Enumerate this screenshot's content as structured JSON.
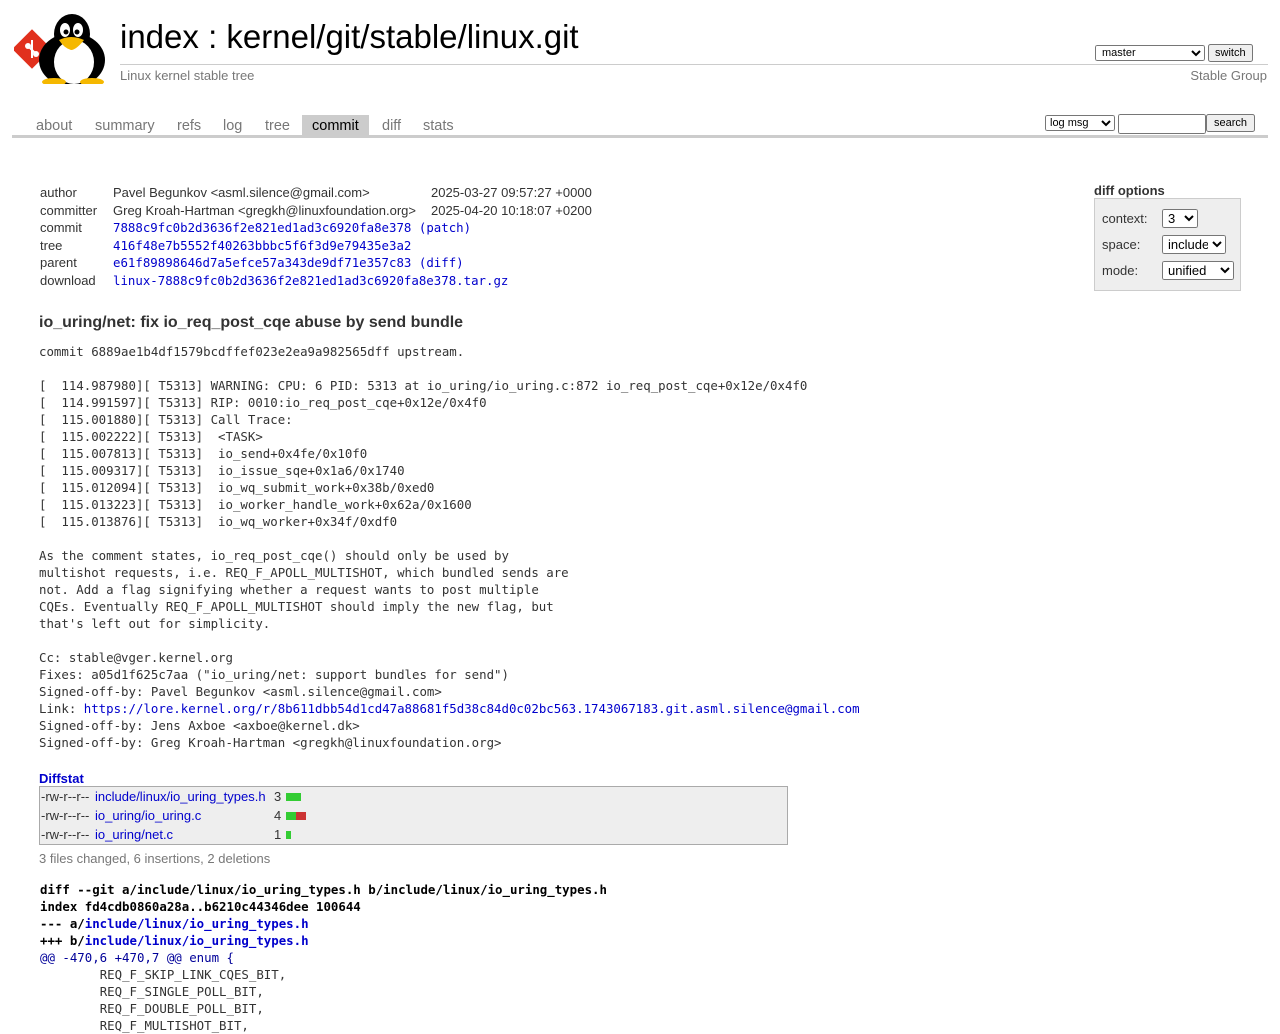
{
  "header": {
    "index_label": "index",
    "separator": ":",
    "repo_path": "kernel/git/stable/linux.git",
    "description": "Linux kernel stable tree",
    "owner": "Stable Group",
    "branch": "master",
    "switch_label": "switch"
  },
  "tabs": [
    {
      "label": "about"
    },
    {
      "label": "summary"
    },
    {
      "label": "refs"
    },
    {
      "label": "log"
    },
    {
      "label": "tree"
    },
    {
      "label": "commit",
      "active": true
    },
    {
      "label": "diff"
    },
    {
      "label": "stats"
    }
  ],
  "search": {
    "mode": "log msg",
    "query": "",
    "button": "search"
  },
  "commit_info": {
    "author": {
      "label": "author",
      "value": "Pavel Begunkov <asml.silence@gmail.com>",
      "date": "2025-03-27 09:57:27 +0000"
    },
    "committer": {
      "label": "committer",
      "value": "Greg Kroah-Hartman <gregkh@linuxfoundation.org>",
      "date": "2025-04-20 10:18:07 +0200"
    },
    "commit": {
      "label": "commit",
      "hash": "7888c9fc0b2d3636f2e821ed1ad3c6920fa8e378",
      "extra": "(patch)"
    },
    "tree": {
      "label": "tree",
      "hash": "416f48e7b5552f40263bbbc5f6f3d9e79435e3a2"
    },
    "parent": {
      "label": "parent",
      "hash": "e61f89898646d7a5efce57a343de9df71e357c83",
      "extra": "(diff)"
    },
    "download": {
      "label": "download",
      "file": "linux-7888c9fc0b2d3636f2e821ed1ad3c6920fa8e378.tar.gz"
    }
  },
  "diff_options": {
    "title": "diff options",
    "context_label": "context:",
    "context_value": "3",
    "space_label": "space:",
    "space_value": "include",
    "mode_label": "mode:",
    "mode_value": "unified"
  },
  "subject": "io_uring/net: fix io_req_post_cqe abuse by send bundle",
  "message": {
    "body": "commit 6889ae1b4df1579bcdffef023e2ea9a982565dff upstream.\n\n[  114.987980][ T5313] WARNING: CPU: 6 PID: 5313 at io_uring/io_uring.c:872 io_req_post_cqe+0x12e/0x4f0\n[  114.991597][ T5313] RIP: 0010:io_req_post_cqe+0x12e/0x4f0\n[  115.001880][ T5313] Call Trace:\n[  115.002222][ T5313]  <TASK>\n[  115.007813][ T5313]  io_send+0x4fe/0x10f0\n[  115.009317][ T5313]  io_issue_sqe+0x1a6/0x1740\n[  115.012094][ T5313]  io_wq_submit_work+0x38b/0xed0\n[  115.013223][ T5313]  io_worker_handle_work+0x62a/0x1600\n[  115.013876][ T5313]  io_wq_worker+0x34f/0xdf0\n\nAs the comment states, io_req_post_cqe() should only be used by\nmultishot requests, i.e. REQ_F_APOLL_MULTISHOT, which bundled sends are\nnot. Add a flag signifying whether a request wants to post multiple\nCQEs. Eventually REQ_F_APOLL_MULTISHOT should imply the new flag, but\nthat's left out for simplicity.\n\nCc: stable@vger.kernel.org\nFixes: a05d1f625c7aa (\"io_uring/net: support bundles for send\")\nSigned-off-by: Pavel Begunkov <asml.silence@gmail.com>",
    "link_prefix": "Link: ",
    "link_url": "https://lore.kernel.org/r/8b611dbb54d1cd47a88681f5d38c84d0c02bc563.1743067183.git.asml.silence@gmail.com",
    "tail": "Signed-off-by: Jens Axboe <axboe@kernel.dk>\nSigned-off-by: Greg Kroah-Hartman <gregkh@linuxfoundation.org>"
  },
  "diffstat": {
    "header": "Diffstat",
    "files": [
      {
        "mode": "-rw-r--r--",
        "path": "include/linux/io_uring_types.h",
        "changes": "3",
        "insertions": 3,
        "deletions": 0
      },
      {
        "mode": "-rw-r--r--",
        "path": "io_uring/io_uring.c",
        "changes": "4",
        "insertions": 2,
        "deletions": 2
      },
      {
        "mode": "-rw-r--r--",
        "path": "io_uring/net.c",
        "changes": "1",
        "insertions": 1,
        "deletions": 0
      }
    ],
    "summary": "3 files changed, 6 insertions, 2 deletions",
    "colors": {
      "insertion": "#33cc33",
      "deletion": "#cc3333"
    }
  },
  "diff": {
    "git_line": "diff --git a/include/linux/io_uring_types.h b/include/linux/io_uring_types.h",
    "index_line": "index fd4cdb0860a28a..b6210c44346dee 100644",
    "minus_prefix": "--- a/",
    "minus_path": "include/linux/io_uring_types.h",
    "plus_prefix": "+++ b/",
    "plus_path": "include/linux/io_uring_types.h",
    "hunk": "@@ -470,6 +470,7 @@ enum {",
    "context_lines": "\tREQ_F_SKIP_LINK_CQES_BIT,\n\tREQ_F_SINGLE_POLL_BIT,\n\tREQ_F_DOUBLE_POLL_BIT,\n\tREQ_F_MULTISHOT_BIT,"
  }
}
